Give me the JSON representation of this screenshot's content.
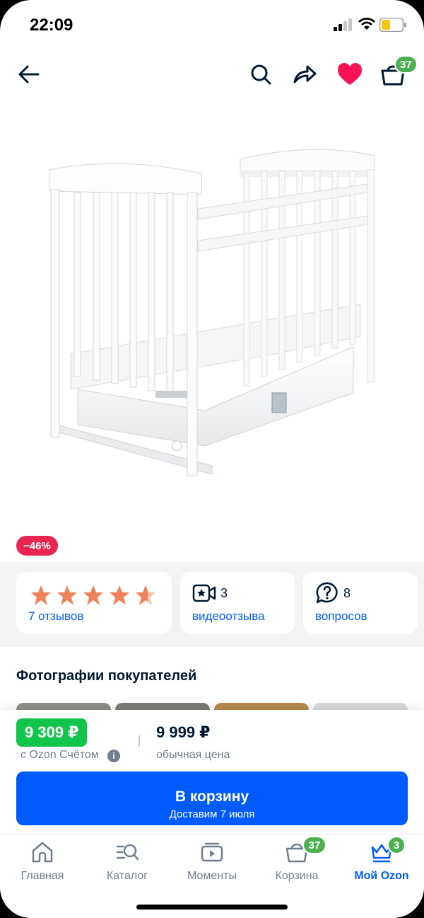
{
  "status_bar": {
    "time": "22:09"
  },
  "header": {
    "cart_badge": "37"
  },
  "product": {
    "discount": "−46%"
  },
  "rating": {
    "stars": 4.5,
    "reviews_label": "7 отзывов"
  },
  "videos": {
    "count": "3",
    "label": "видеоотзыва"
  },
  "questions": {
    "count": "8",
    "label": "вопросов"
  },
  "photos": {
    "title": "Фотографии покупателей"
  },
  "price": {
    "card_price": "9 309 ₽",
    "card_price_note": "с Ozon Счётом",
    "regular_price": "9 999 ₽",
    "regular_price_note": "обычная цена"
  },
  "cart_button": {
    "label": "В корзину",
    "delivery": "Доставим 7 июля"
  },
  "tabbar": {
    "items": [
      {
        "label": "Главная",
        "icon": "home-icon"
      },
      {
        "label": "Каталог",
        "icon": "catalog-icon"
      },
      {
        "label": "Моменты",
        "icon": "moments-icon"
      },
      {
        "label": "Корзина",
        "icon": "cart-icon",
        "badge": "37"
      },
      {
        "label": "Мой Ozon",
        "icon": "crown-icon",
        "badge": "3",
        "active": true
      }
    ]
  },
  "colors": {
    "accent": "#005bff",
    "green": "#10c44c",
    "badge_green": "#4caf50",
    "discount": "#e8264f",
    "heart": "#f91155",
    "star": "#f0825a"
  }
}
